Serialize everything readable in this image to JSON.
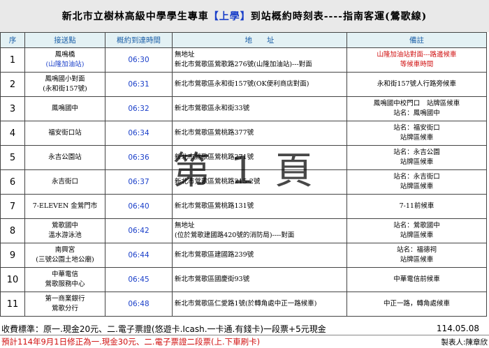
{
  "title": {
    "prefix": "新北市立樹林高級中學學生專車",
    "bracket": "【上學】",
    "middle": "到站概約時刻表----",
    "route": "指南客運(鶯歌線)"
  },
  "headers": [
    "序",
    "接送點",
    "概約到達時間",
    "地　　址",
    "備註"
  ],
  "rows": [
    {
      "seq": "1",
      "stop": [
        "鳳鳴橋",
        "(山隆加油站)"
      ],
      "time": "06:30",
      "addr": [
        "無地址",
        "新北市鶯歌區鶯歌路276號(山隆加油站)---對面"
      ],
      "note": [
        "山隆加油站對面---路邊候車",
        "等候車時間"
      ],
      "note_red": true
    },
    {
      "seq": "2",
      "stop": [
        "鳳鳴國小對面",
        "(永和街157號)"
      ],
      "time": "06:31",
      "addr": [
        "新北市鶯歌區永和街157號(OK便利商店對面)"
      ],
      "note": [
        "永和街157號人行路旁候車"
      ],
      "note_red": false
    },
    {
      "seq": "3",
      "stop": [
        "鳳鳴國中"
      ],
      "time": "06:32",
      "addr": [
        "新北市鶯歌區永和街33號"
      ],
      "note": [
        "鳳鳴國中校門口　站牌區候車",
        "站名：鳳鳴國中"
      ],
      "note_red": false
    },
    {
      "seq": "4",
      "stop": [
        "福安街口站"
      ],
      "time": "06:34",
      "addr": [
        "新北市鶯歌區鶯桃路377號"
      ],
      "note": [
        "站名：福安街口",
        "站牌區候車"
      ],
      "note_red": false
    },
    {
      "seq": "5",
      "stop": [
        "永吉公園站"
      ],
      "time": "06:36",
      "addr": [
        "新北市鶯歌區鶯桃路271號"
      ],
      "note": [
        "站名：永吉公園",
        "站牌區候車"
      ],
      "note_red": false
    },
    {
      "seq": "6",
      "stop": [
        "永吉街口"
      ],
      "time": "06:37",
      "addr": [
        "新北市鶯歌區鶯桃路215-2號"
      ],
      "note": [
        "站名：永吉街口",
        "站牌區候車"
      ],
      "note_red": false
    },
    {
      "seq": "7",
      "stop": [
        "7-ELEVEN 金鶯門市"
      ],
      "time": "06:40",
      "addr": [
        "新北市鶯歌區鶯桃路131號"
      ],
      "note": [
        "7-11前候車"
      ],
      "note_red": false
    },
    {
      "seq": "8",
      "stop": [
        "鶯歌國中",
        "溫水游泳池"
      ],
      "time": "06:42",
      "addr": [
        "無地址",
        "(位於鶯歌建國路420號的消防局)----對面"
      ],
      "note": [
        "站名：鶯歌國中",
        "站牌區候車"
      ],
      "note_red": false
    },
    {
      "seq": "9",
      "stop": [
        "南興宮",
        "(三號公園土地公廟)"
      ],
      "time": "06:44",
      "addr": [
        "新北市鶯歌區建國路239號"
      ],
      "note": [
        "站名：福德祠",
        "站牌區候車"
      ],
      "note_red": false
    },
    {
      "seq": "10",
      "stop": [
        "中華電信",
        "鶯歌服務中心"
      ],
      "time": "06:45",
      "addr": [
        "新北市鶯歌區國慶街93號"
      ],
      "note": [
        "中華電信前候車"
      ],
      "note_red": false
    },
    {
      "seq": "11",
      "stop": [
        "第一商業銀行",
        "鶯歌分行"
      ],
      "time": "06:48",
      "addr": [
        "新北市鶯歌區仁愛路1號(於轉角處中正一路候車)"
      ],
      "note": [
        "中正一路，轉角處候車"
      ],
      "note_red": false
    }
  ],
  "watermark": "第 1 頁",
  "footer": {
    "fee": "收費標準：原一.現金20元、二.電子票證(悠遊卡.Icash.一卡通.有錢卡)一段票+5元現金",
    "date": "114.05.08",
    "notice": "預計114年9月1日修正為一.現金30元、二.電子票證二段票(上.下車刷卡)",
    "maker": "製表人:陳章欣"
  },
  "colors": {
    "header_bg": "#e3f1f4",
    "header_text": "#1b5fa8",
    "time_text": "#1a3fc9",
    "alert": "#d01010",
    "title_bg": "#e9e9e9"
  }
}
